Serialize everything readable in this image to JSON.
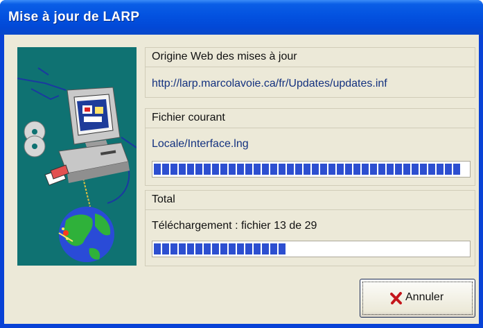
{
  "window": {
    "title": "Mise à jour de LARP"
  },
  "source_group": {
    "heading": "Origine Web des mises à jour",
    "url": "http://larp.marcolavoie.ca/fr/Updates/updates.inf"
  },
  "current_file_group": {
    "heading": "Fichier courant",
    "file": "Locale/Interface.lng",
    "progress_fraction": 1.0
  },
  "total_group": {
    "heading": "Total",
    "status": "Téléchargement : fichier 13 de 29",
    "progress_fraction": 0.44
  },
  "cancel_button": {
    "label": "Annuler",
    "icon": "red-x-icon"
  },
  "colors": {
    "titlebar": "#0352e0",
    "client_bg": "#ece9d8",
    "illustration_bg": "#0f7272",
    "progress_blue": "#2d4fd0",
    "link_text": "#13317f",
    "cancel_icon_red": "#c4161c"
  }
}
